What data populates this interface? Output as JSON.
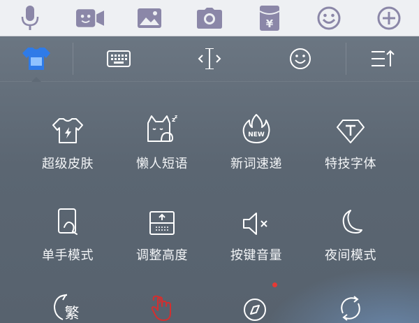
{
  "top_toolbar": {
    "icons": [
      "microphone-icon",
      "video-face-icon",
      "image-icon",
      "camera-icon",
      "red-packet-icon",
      "emoji-icon",
      "add-icon"
    ]
  },
  "tabs": {
    "icons": [
      "skin-tshirt-icon",
      "keyboard-icon",
      "cursor-icon",
      "smiley-icon",
      "menu-sort-icon"
    ],
    "active_index": 0
  },
  "grid": {
    "rows": [
      [
        {
          "label": "超级皮肤",
          "icon": "tshirt-icon"
        },
        {
          "label": "懒人短语",
          "icon": "sleepy-cat-icon"
        },
        {
          "label": "新词速递",
          "icon": "fire-new-icon"
        },
        {
          "label": "特技字体",
          "icon": "diamond-font-icon"
        }
      ],
      [
        {
          "label": "单手模式",
          "icon": "one-hand-icon"
        },
        {
          "label": "调整高度",
          "icon": "adjust-height-icon"
        },
        {
          "label": "按键音量",
          "icon": "speaker-mute-icon"
        },
        {
          "label": "夜间模式",
          "icon": "moon-icon"
        }
      ],
      [
        {
          "label": "",
          "icon": "traditional-chinese-icon",
          "glyph": "繁"
        },
        {
          "label": "",
          "icon": "gesture-hand-icon"
        },
        {
          "label": "",
          "icon": "compass-icon"
        },
        {
          "label": "",
          "icon": "sync-icon"
        }
      ]
    ]
  },
  "colors": {
    "accent": "#3b82f6",
    "panel": "#5b6672",
    "icon_white": "#ffffff",
    "hand_red": "#d32f2f",
    "badge": "#e53935",
    "toolbar_icon": "#8b87a8"
  }
}
